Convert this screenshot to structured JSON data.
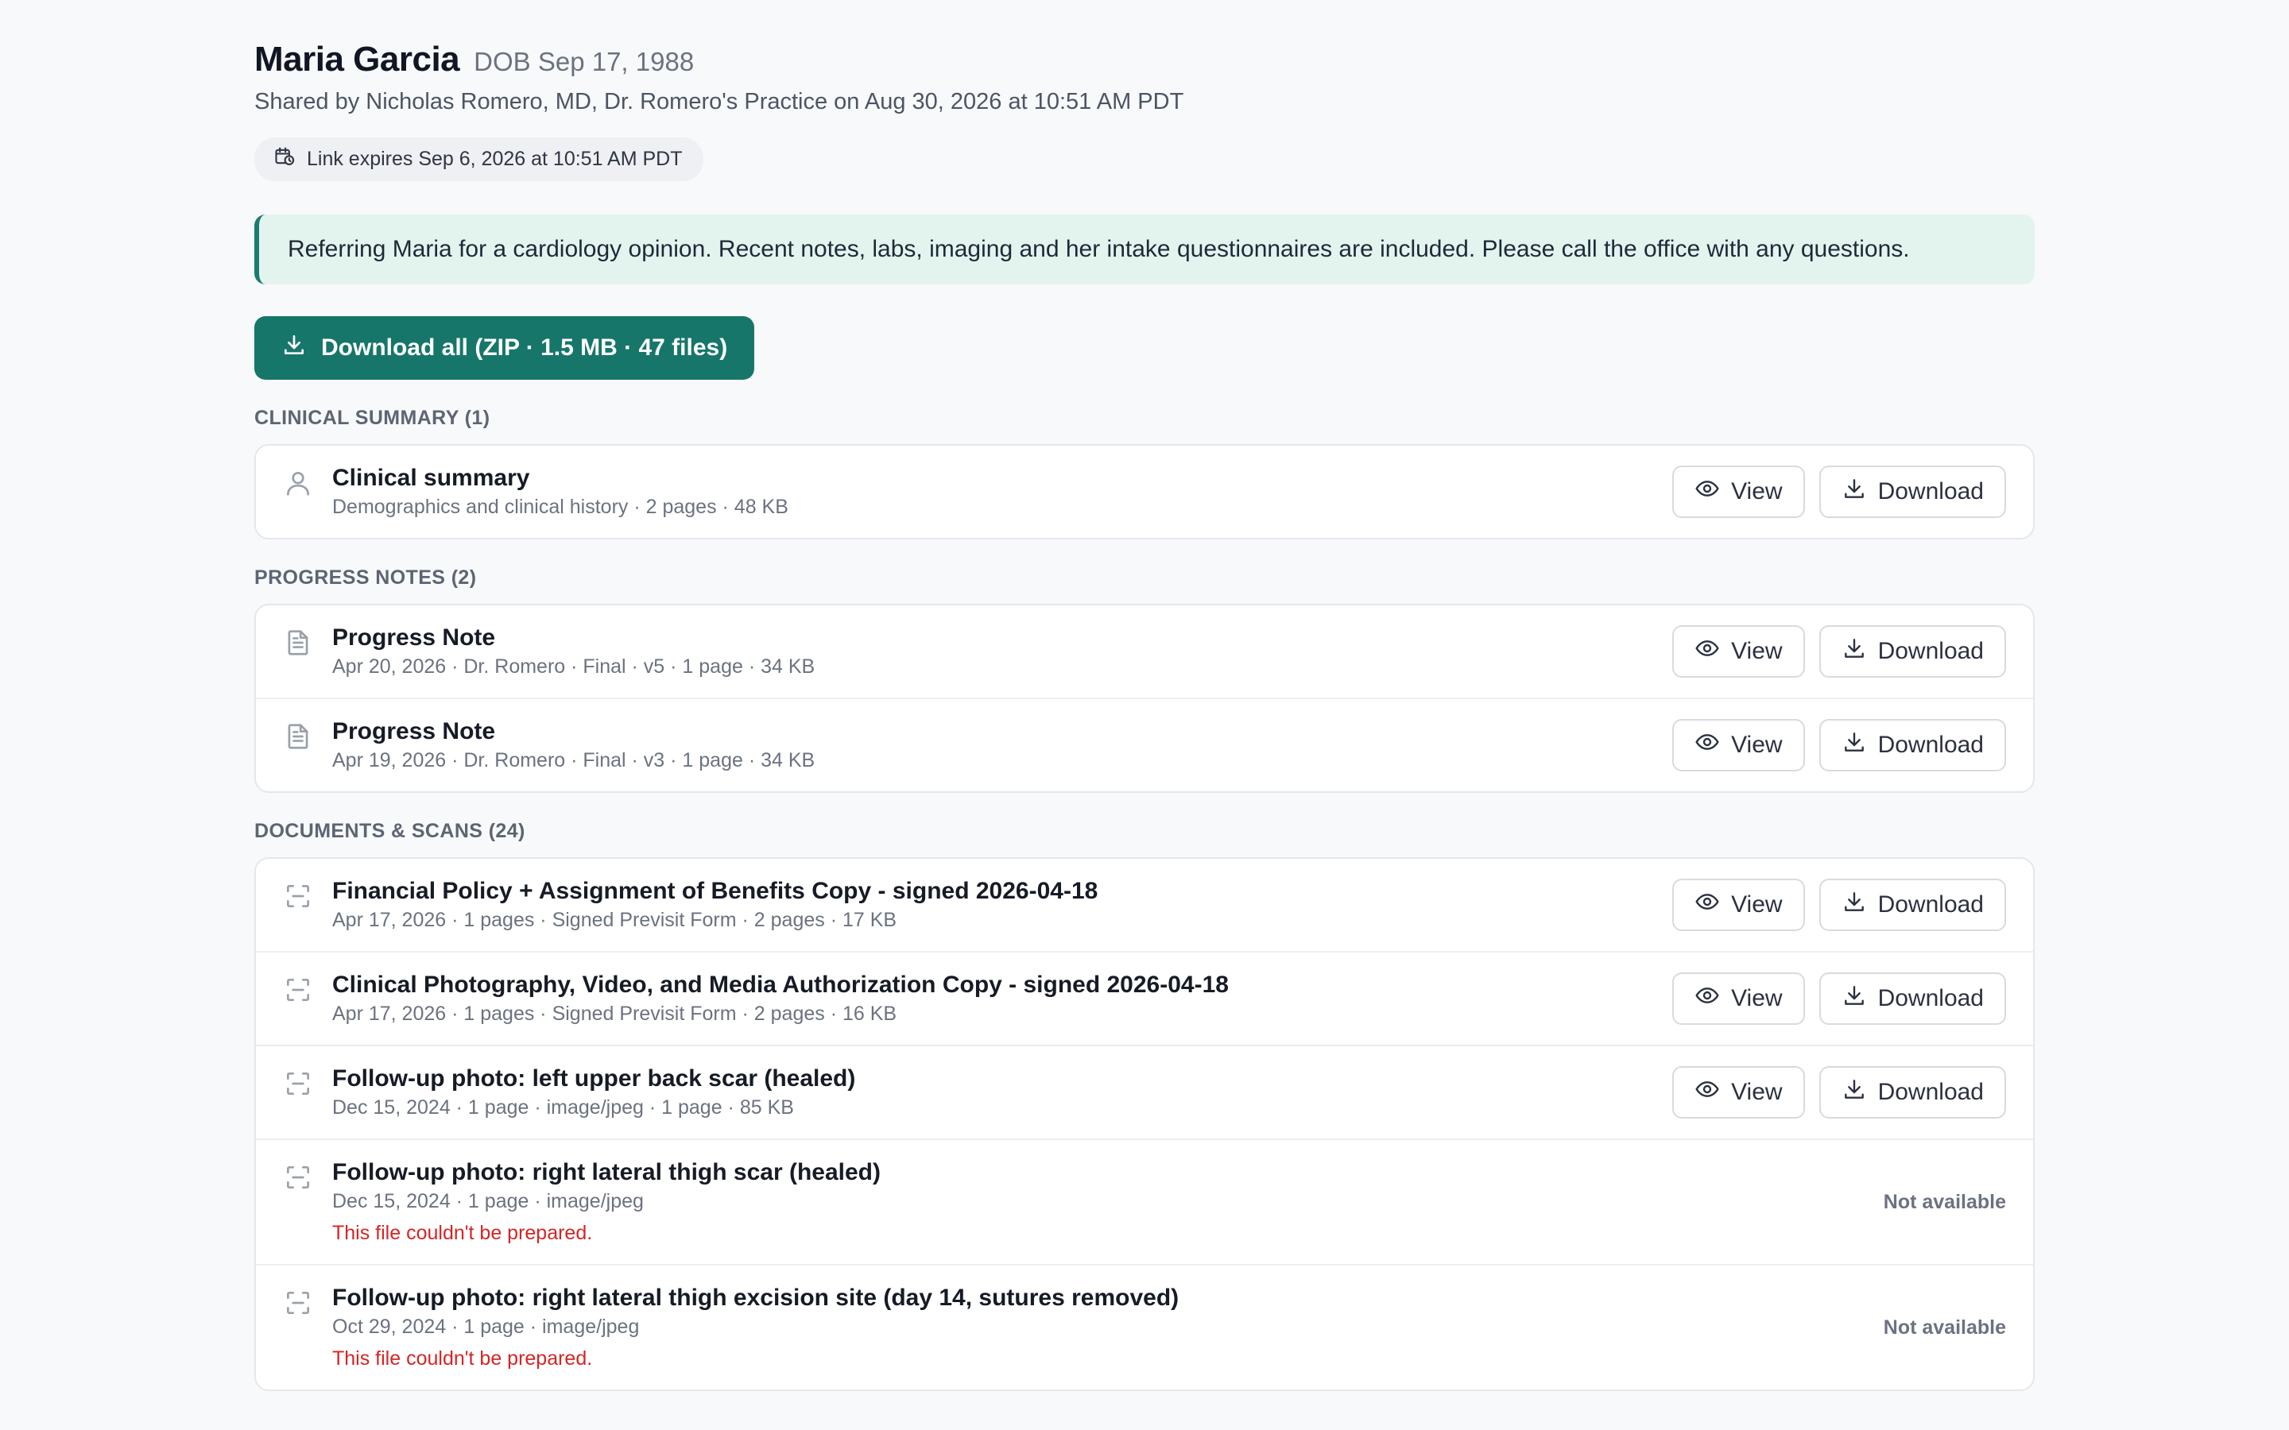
{
  "patient": {
    "name": "Maria Garcia",
    "dob": "DOB Sep 17, 1988",
    "shared_by": "Shared by Nicholas Romero, MD, Dr. Romero's Practice on Aug 30, 2026 at 10:51 AM PDT",
    "link_expiry": "Link expires Sep 6, 2026 at 10:51 AM PDT"
  },
  "note": "Referring Maria for a cardiology opinion. Recent notes, labs, imaging and her intake questionnaires are included. Please call the office with any questions.",
  "download_all_label": "Download all (ZIP · 1.5 MB · 47 files)",
  "labels": {
    "view": "View",
    "download": "Download",
    "not_available": "Not available",
    "error": "This file couldn't be prepared."
  },
  "sections": [
    {
      "heading": "CLINICAL SUMMARY (1)",
      "icon": "person-icon",
      "items": [
        {
          "title": "Clinical summary",
          "meta": "Demographics and clinical history · 2 pages · 48 KB",
          "available": true
        }
      ]
    },
    {
      "heading": "PROGRESS NOTES (2)",
      "icon": "document-icon",
      "items": [
        {
          "title": "Progress Note",
          "meta": "Apr 20, 2026 · Dr. Romero · Final · v5 · 1 page · 34 KB",
          "available": true
        },
        {
          "title": "Progress Note",
          "meta": "Apr 19, 2026 · Dr. Romero · Final · v3 · 1 page · 34 KB",
          "available": true
        }
      ]
    },
    {
      "heading": "DOCUMENTS & SCANS (24)",
      "icon": "scan-icon",
      "items": [
        {
          "title": "Financial Policy + Assignment of Benefits Copy - signed 2026-04-18",
          "meta": "Apr 17, 2026 · 1 pages · Signed Previsit Form · 2 pages · 17 KB",
          "available": true
        },
        {
          "title": "Clinical Photography, Video, and Media Authorization Copy - signed 2026-04-18",
          "meta": "Apr 17, 2026 · 1 pages · Signed Previsit Form · 2 pages · 16 KB",
          "available": true
        },
        {
          "title": "Follow-up photo: left upper back scar (healed)",
          "meta": "Dec 15, 2024 · 1 page · image/jpeg · 1 page · 85 KB",
          "available": true
        },
        {
          "title": "Follow-up photo: right lateral thigh scar (healed)",
          "meta": "Dec 15, 2024 · 1 page · image/jpeg",
          "available": false
        },
        {
          "title": "Follow-up photo: right lateral thigh excision site (day 14, sutures removed)",
          "meta": "Oct 29, 2024 · 1 page · image/jpeg",
          "available": false
        }
      ]
    }
  ]
}
